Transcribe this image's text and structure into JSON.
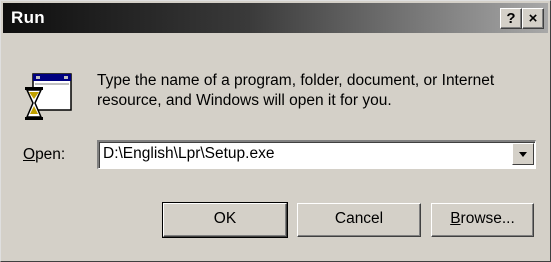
{
  "dialog": {
    "title": "Run",
    "help_label": "?",
    "close_label": "×",
    "description": "Type the name of a program, folder, document, or Internet resource, and Windows will open it for you.",
    "open_label_first": "O",
    "open_label_rest": "pen:",
    "open_value": "D:\\English\\Lpr\\Setup.exe",
    "ok_label": "OK",
    "cancel_label": "Cancel",
    "browse_label_first": "B",
    "browse_label_rest": "rowse..."
  },
  "icons": {
    "run": "run-program-icon",
    "help": "help-icon",
    "close": "close-icon",
    "dropdown": "chevron-down-icon"
  }
}
